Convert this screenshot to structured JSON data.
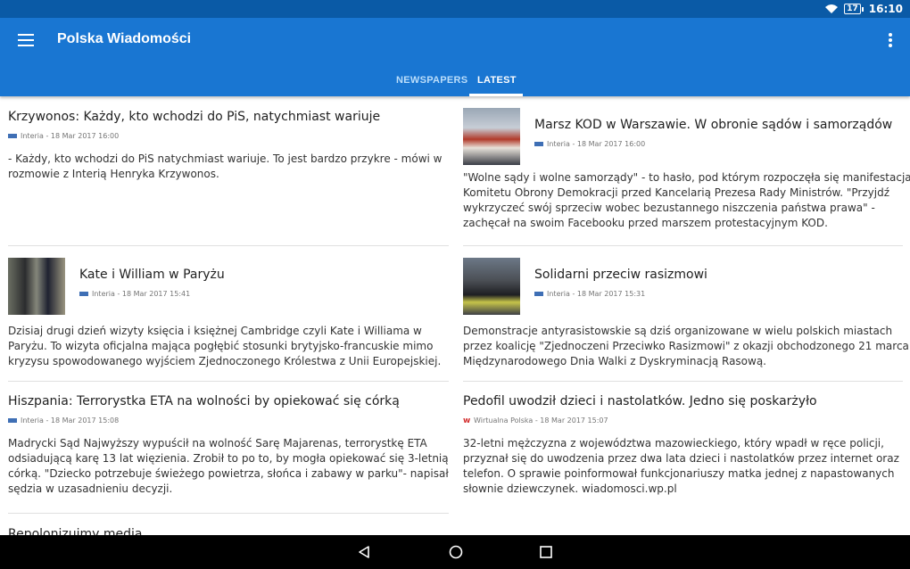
{
  "status": {
    "battery": "17",
    "time": "16:10"
  },
  "app": {
    "title": "Polska Wiadomości"
  },
  "tabs": [
    {
      "label": "NEWSPAPERS",
      "active": false
    },
    {
      "label": "LATEST",
      "active": true
    }
  ],
  "articles": [
    {
      "title": "Krzywonos: Każdy, kto wchodzi do PiS, natychmiast wariuje",
      "meta": "Interia - 18 Mar 2017 16:00",
      "desc": "- Każdy, kto wchodzi do PiS natychmiast wariuje. To jest bardzo przykre - mówi w rozmowie z Interią Henryka Krzywonos."
    },
    {
      "title": "Marsz KOD w Warszawie. W obronie sądów i samorządów",
      "meta": "Interia - 18 Mar 2017 16:00",
      "desc": "\"Wolne sądy i wolne samorządy\" - to hasło, pod którym rozpoczęła się manifestacja Komitetu Obrony Demokracji przed Kancelarią Prezesa Rady Ministrów. \"Przyjdź wykrzyczeć swój sprzeciw wobec bezustannego niszczenia państwa prawa\" - zachęcał na swoim Facebooku przed marszem protestacyjnym KOD."
    },
    {
      "title": "Kate i William w Paryżu",
      "meta": "Interia - 18 Mar 2017 15:41",
      "desc": "Dzisiaj drugi dzień wizyty księcia i księżnej Cambridge czyli Kate i Williama w Paryżu. To wizyta oficjalna mająca pogłębić stosunki brytyjsko-francuskie mimo kryzysu spowodowanego wyjściem Zjednoczonego Królestwa z Unii Europejskiej."
    },
    {
      "title": "Solidarni przeciw rasizmowi",
      "meta": "Interia - 18 Mar 2017 15:31",
      "desc": "Demonstracje antyrasistowskie są dziś organizowane w wielu polskich miastach przez koalicję \"Zjednoczeni Przeciwko Rasizmowi\" z okazji obchodzonego 21 marca Międzynarodowego Dnia Walki z Dyskryminacją Rasową."
    },
    {
      "title": "Hiszpania: Terrorystka ETA na wolności by opiekować się córką",
      "meta": "Interia - 18 Mar 2017 15:08",
      "desc": "Madrycki Sąd Najwyższy wypuścił na wolność Sarę Majarenas, terrorystkę ETA odsiadującą karę 13 lat więzienia. Zrobił to po to, by mogła opiekować się 3-letnią córką. \"Dziecko potrzebuje świeżego powietrza, słońca i zabawy w parku\"- napisał sędzia w uzasadnieniu decyzji."
    },
    {
      "title": "Pedofil uwodził dzieci i nastolatków. Jedno się poskarżyło",
      "meta": "Wirtualna Polska - 18 Mar 2017 15:07",
      "desc": "32-letni mężczyzna z województwa mazowieckiego, który wpadł w ręce policji, przyznał się do uwodzenia przez dwa lata dzieci i nastolatków przez internet oraz telefon. O sprawie poinformował funkcjonariuszy matka jednej z napastowanych słownie dziewczynek. wiadomosci.wp.pl"
    },
    {
      "title": "Repolonizujmy media"
    }
  ]
}
